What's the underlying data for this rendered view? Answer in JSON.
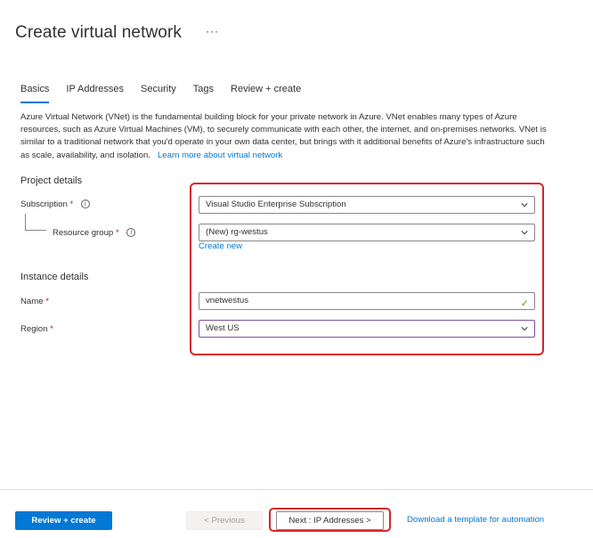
{
  "page": {
    "title": "Create virtual network",
    "more": "···"
  },
  "tabs": [
    {
      "label": "Basics",
      "active": true
    },
    {
      "label": "IP Addresses"
    },
    {
      "label": "Security"
    },
    {
      "label": "Tags"
    },
    {
      "label": "Review + create"
    }
  ],
  "intro": {
    "text": "Azure Virtual Network (VNet) is the fundamental building block for your private network in Azure. VNet enables many types of Azure resources, such as Azure Virtual Machines (VM), to securely communicate with each other, the internet, and on-premises networks. VNet is similar to a traditional network that you'd operate in your own data center, but brings with it additional benefits of Azure's infrastructure such as scale, availability, and isolation.",
    "link": "Learn more about virtual network"
  },
  "project": {
    "heading": "Project details",
    "subscription_label": "Subscription",
    "subscription_value": "Visual Studio Enterprise Subscription",
    "rg_label": "Resource group",
    "rg_value": "(New) rg-westus",
    "create_new": "Create new"
  },
  "instance": {
    "heading": "Instance details",
    "name_label": "Name",
    "name_value": "vnetwestus",
    "region_label": "Region",
    "region_value": "West US"
  },
  "required_mark": "*",
  "footer": {
    "review_create": "Review + create",
    "previous": "< Previous",
    "next": "Next : IP Addresses >",
    "download": "Download a template for automation"
  },
  "colors": {
    "accent": "#0078d4",
    "highlight": "#d9222a",
    "valid": "#57a300"
  }
}
